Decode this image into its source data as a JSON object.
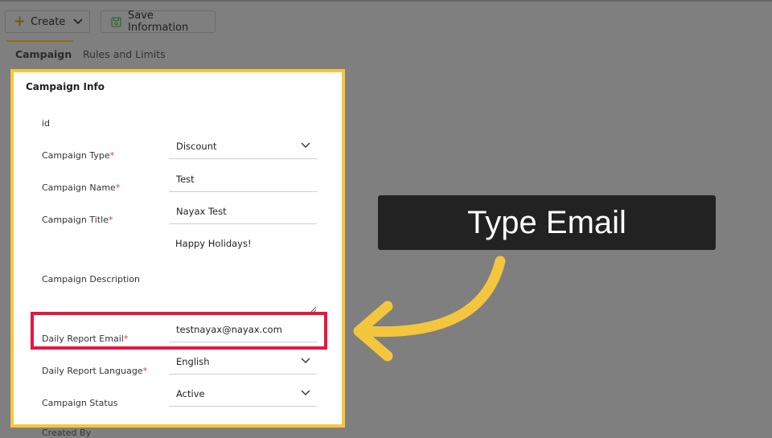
{
  "toolbar": {
    "create_label": "Create",
    "save_label": "Save Information"
  },
  "tabs": [
    {
      "label": "Campaign",
      "active": true
    },
    {
      "label": "Rules and Limits",
      "active": false
    }
  ],
  "panel": {
    "title": "Campaign Info",
    "fields": {
      "id": {
        "label": "id"
      },
      "type": {
        "label": "Campaign Type",
        "value": "Discount"
      },
      "name": {
        "label": "Campaign Name",
        "value": "Test"
      },
      "title": {
        "label": "Campaign Title",
        "value": "Nayax Test"
      },
      "description": {
        "label": "Campaign Description",
        "value": "Happy Holidays!"
      },
      "email": {
        "label": "Daily Report Email",
        "value": "testnayax@nayax.com"
      },
      "language": {
        "label": "Daily Report Language",
        "value": "English"
      },
      "status": {
        "label": "Campaign Status",
        "value": "Active"
      },
      "created_by": {
        "label": "Created By"
      }
    },
    "required_mark": "*"
  },
  "callout": {
    "text": "Type Email"
  },
  "colors": {
    "highlight_panel": "#f4c63d",
    "highlight_field": "#e5173f",
    "arrow": "#f4c63d",
    "callout_bg": "#222222",
    "required": "#e53935"
  },
  "icons": [
    "plus-icon",
    "chevron-down-icon",
    "save-icon",
    "resize-handle-icon",
    "curved-arrow-icon"
  ]
}
